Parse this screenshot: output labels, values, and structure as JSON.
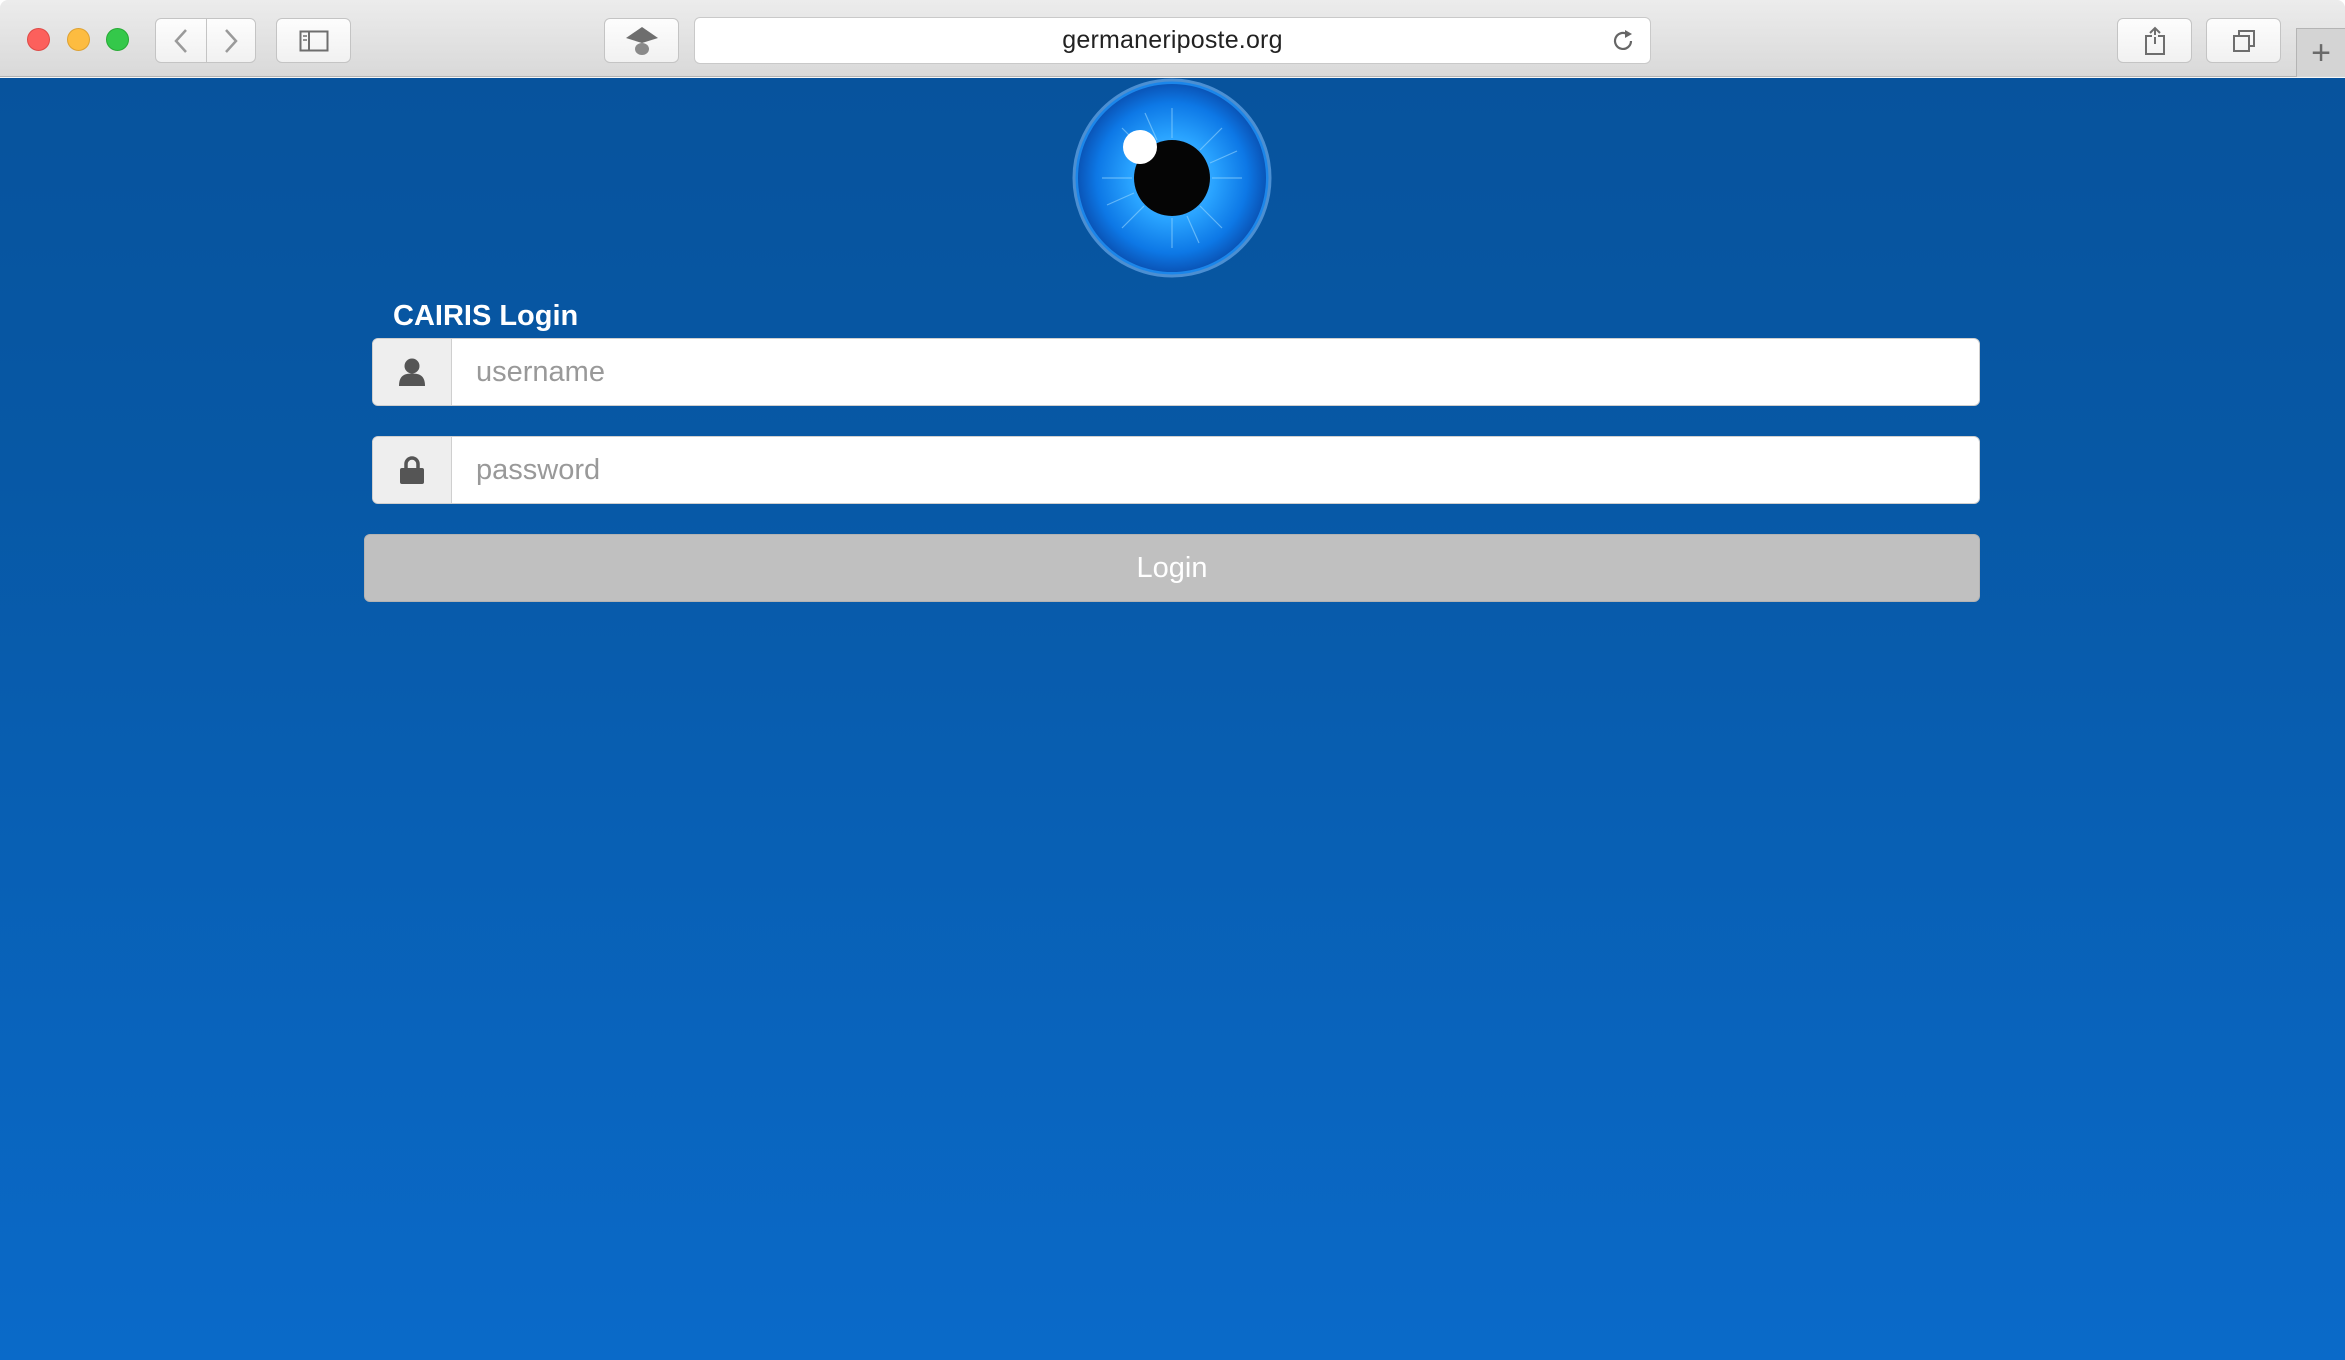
{
  "browser": {
    "url": "germaneriposte.org",
    "new_tab_label": "+"
  },
  "login": {
    "title": "CAIRIS Login",
    "username_placeholder": "username",
    "password_placeholder": "password",
    "button_label": "Login"
  },
  "colors": {
    "page_background_top": "#07539d",
    "page_background_bottom": "#0a6ac9",
    "button_background": "#c0c0c0",
    "title_text": "#ffffff"
  },
  "icons": {
    "username_addon": "user-icon",
    "password_addon": "lock-icon",
    "logo": "eye-logo"
  }
}
